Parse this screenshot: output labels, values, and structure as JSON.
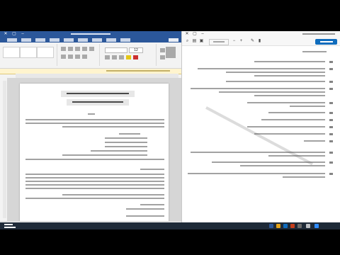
{
  "word_window": {
    "font_size_value": "12",
    "ribbon_tabs": [
      "tab-1",
      "tab-2",
      "tab-3",
      "tab-4",
      "tab-5",
      "tab-6",
      "tab-7",
      "tab-8",
      "tab-9",
      "tab-10"
    ],
    "title_lines": 2,
    "body_lines": 24
  },
  "pdf_viewer": {
    "share_label": "",
    "numbered_items": 13
  },
  "colors": {
    "word_blue": "#2b579a",
    "share_blue": "#0f6cbd",
    "taskbar": "#1e2a38",
    "watermark_gray": "#9c9c9c"
  },
  "icons": [
    "close-icon",
    "maximize-icon",
    "minimize-icon",
    "search-icon",
    "windows-start-icon"
  ]
}
